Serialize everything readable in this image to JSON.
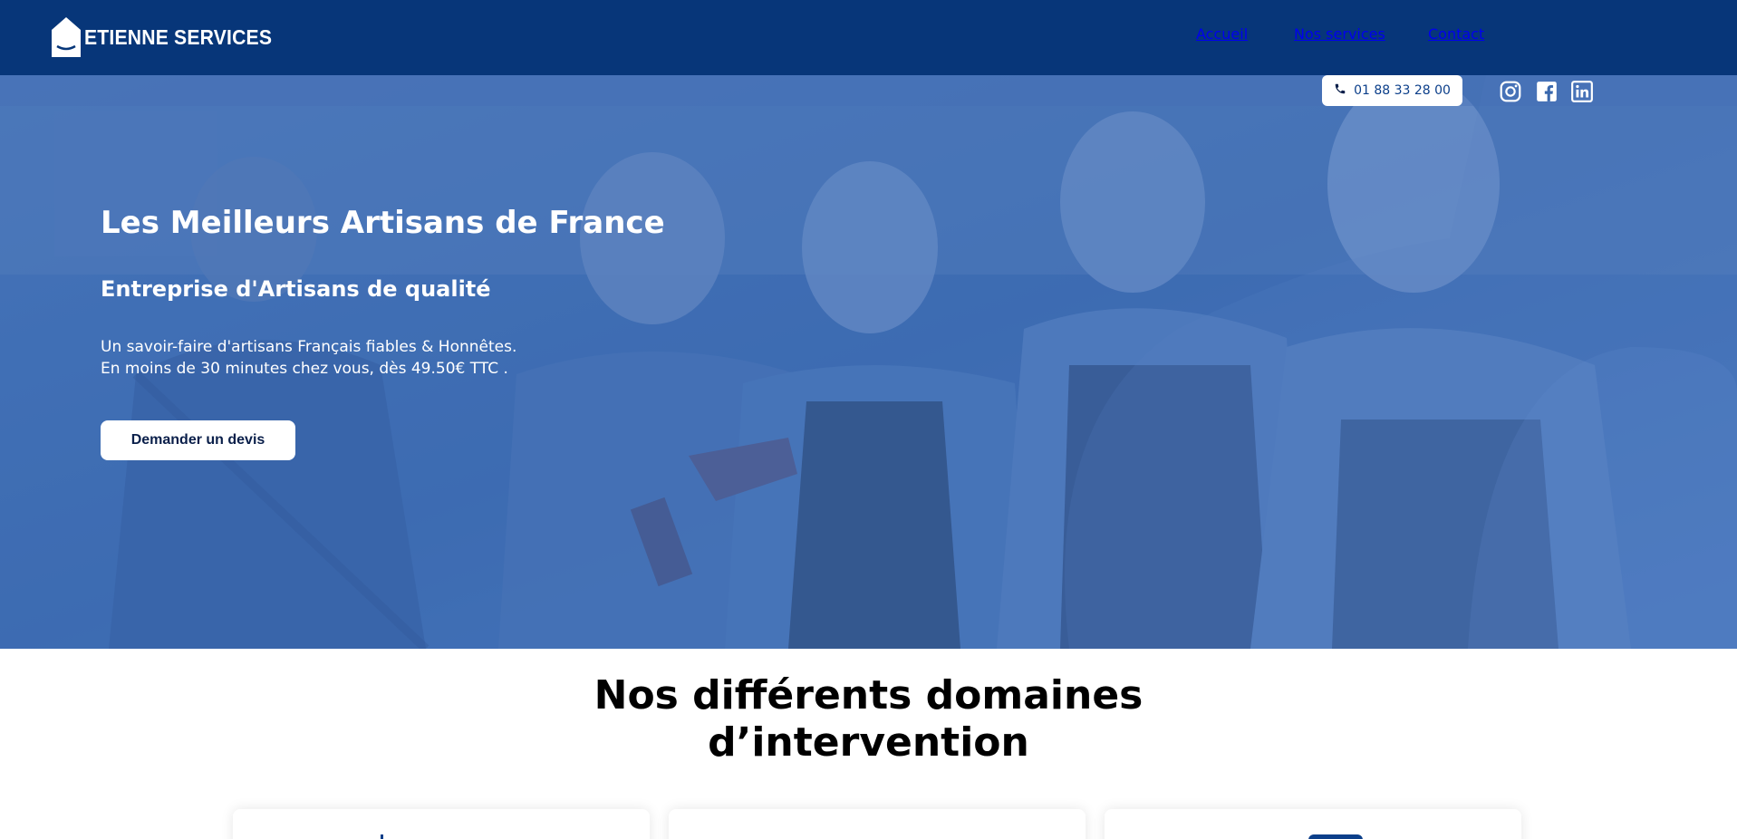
{
  "brand": {
    "name": "ETIENNE SERVICES",
    "logo_icon": "house-icon"
  },
  "nav": {
    "items": [
      {
        "label": "Accueil"
      },
      {
        "label": "Nos services"
      },
      {
        "label": "Contact"
      }
    ]
  },
  "utility": {
    "phone": "01 88 33 28 00",
    "phone_icon": "phone-icon",
    "social": [
      {
        "icon": "instagram-icon"
      },
      {
        "icon": "facebook-icon"
      },
      {
        "icon": "linkedin-icon"
      }
    ]
  },
  "hero": {
    "title": "Les Meilleurs Artisans de France",
    "subtitle": "Entreprise d'Artisans de qualité",
    "line1": "Un savoir-faire d'artisans Français fiables & Honnêtes.",
    "line2": "En moins de 30 minutes chez vous, dès 49.50€ TTC .",
    "cta_label": "Demander un devis"
  },
  "section": {
    "title_line1": "Nos différents domaines",
    "title_line2": "d’intervention"
  },
  "colors": {
    "header_bg": "#073679",
    "hero_overlay": "#3f6fb8",
    "accent": "#0c3f8a"
  }
}
